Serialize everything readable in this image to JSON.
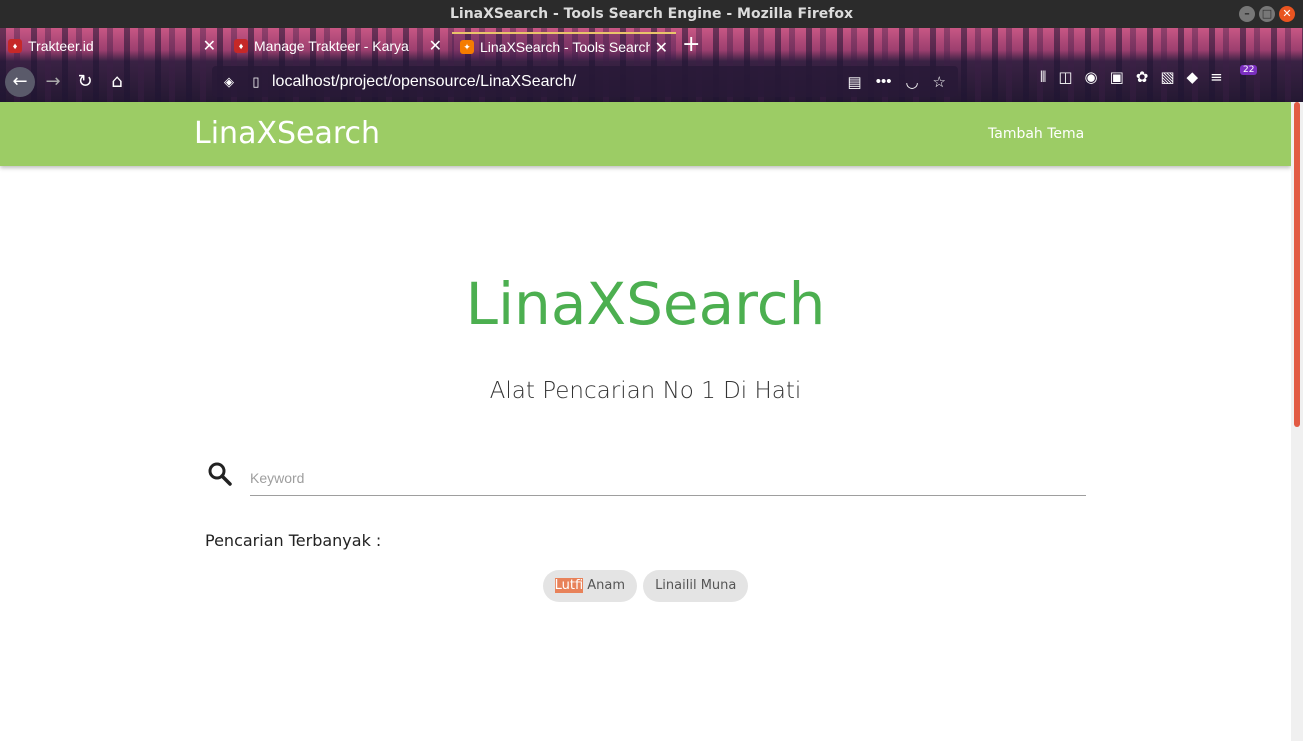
{
  "window": {
    "title": "LinaXSearch - Tools Search Engine - Mozilla Firefox",
    "minimize": "–",
    "maximize": "□",
    "close": "✕"
  },
  "browser": {
    "tabs": [
      {
        "label": "Trakteer.id",
        "favicon": "trakteer-icon",
        "active": false
      },
      {
        "label": "Manage Trakteer - Karya",
        "favicon": "trakteer-icon",
        "active": false
      },
      {
        "label": "LinaXSearch - Tools Search",
        "favicon": "xampp-icon",
        "active": true
      }
    ],
    "new_tab": "+",
    "url": "localhost/project/opensource/LinaXSearch/",
    "extension_badge": "22"
  },
  "app": {
    "brand": "LinaXSearch",
    "nav_link": "Tambah Tema",
    "hero_title": "LinaXSearch",
    "hero_subtitle": "Alat Pencarian No 1 Di Hati",
    "search": {
      "placeholder": "Keyword",
      "value": ""
    },
    "popular_label": "Pencarian Terbanyak :",
    "chips": [
      {
        "highlight": "Lutfi",
        "rest": " Anam"
      },
      {
        "highlight": "",
        "rest": "Linailil Muna"
      }
    ]
  },
  "colors": {
    "nav_green": "#9ccc65",
    "title_green": "#4caf50",
    "highlight": "#e8825a"
  }
}
